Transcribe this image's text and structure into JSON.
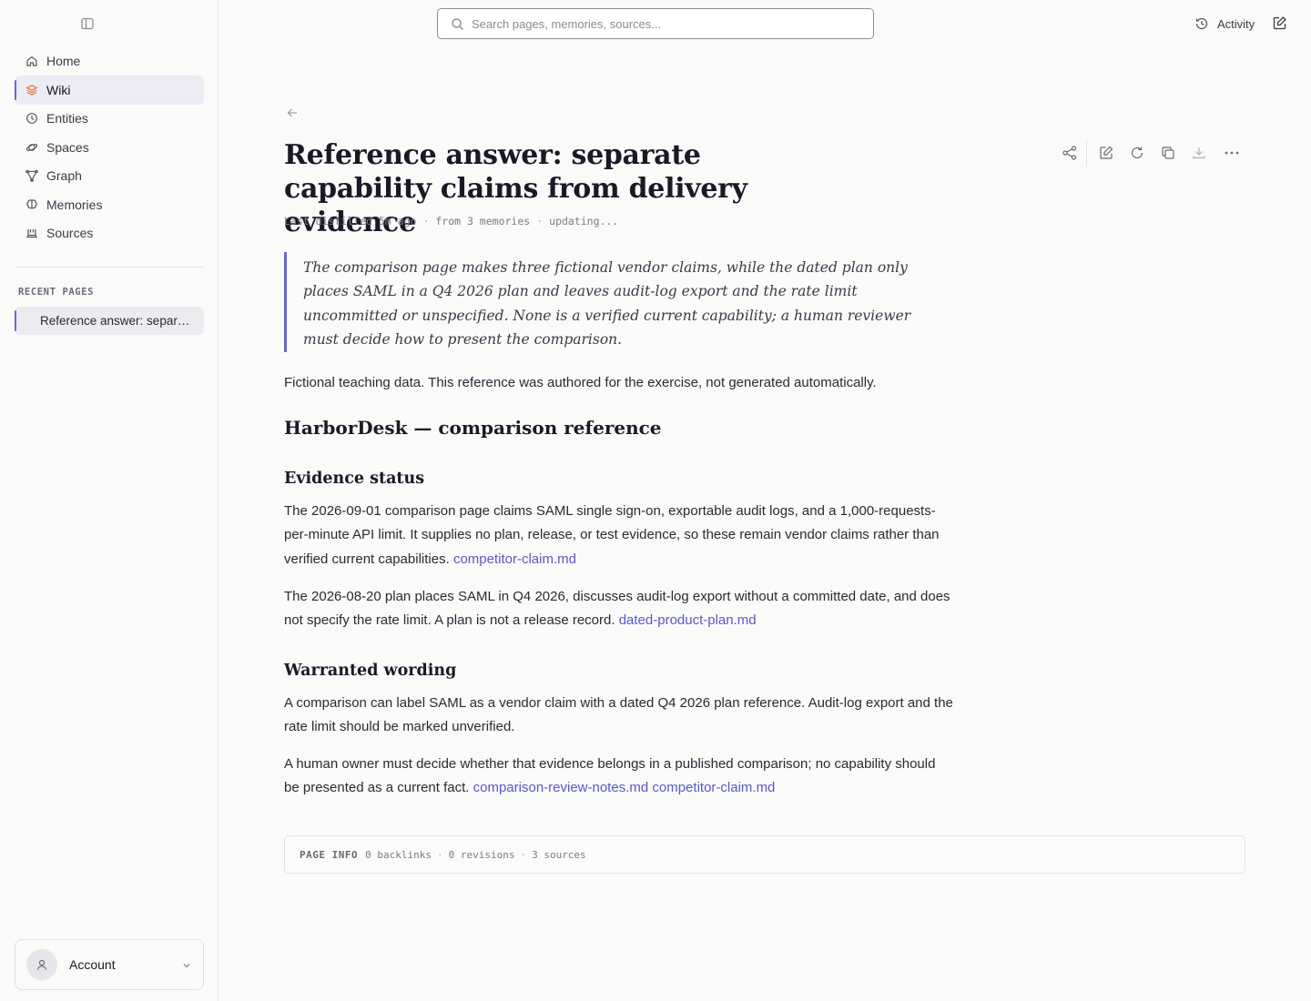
{
  "sidebar": {
    "toggle_icon": "sidebar-toggle-icon",
    "items": [
      {
        "label": "Home",
        "icon": "home-icon",
        "active": false
      },
      {
        "label": "Wiki",
        "icon": "layers-icon",
        "active": true
      },
      {
        "label": "Entities",
        "icon": "clock-icon",
        "active": false
      },
      {
        "label": "Spaces",
        "icon": "orbit-icon",
        "active": false
      },
      {
        "label": "Graph",
        "icon": "graph-icon",
        "active": false
      },
      {
        "label": "Memories",
        "icon": "brain-icon",
        "active": false
      },
      {
        "label": "Sources",
        "icon": "inbox-icon",
        "active": false
      }
    ],
    "recent_title": "RECENT PAGES",
    "recent_pages": [
      "Reference answer: separat..."
    ],
    "account_label": "Account"
  },
  "topbar": {
    "search_placeholder": "Search pages, memories, sources...",
    "activity_label": "Activity"
  },
  "page": {
    "title": "Reference answer: separate capability claims from delivery evidence",
    "meta": {
      "distilled": "Last distilled 5m ago",
      "from": "from 3 memories",
      "status": "updating..."
    },
    "summary": "The comparison page makes three fictional vendor claims, while the dated plan only places SAML in a Q4 2026 plan and leaves audit-log export and the rate limit uncommitted or unspecified. None is a verified current capability; a human reviewer must decide how to present the comparison.",
    "intro": "Fictional teaching data. This reference was authored for the exercise, not generated automatically.",
    "h2": "HarborDesk — comparison reference",
    "sections": [
      {
        "heading": "Evidence status",
        "paragraphs": [
          {
            "text": "The 2026-09-01 comparison page claims SAML single sign-on, exportable audit logs, and a 1,000-requests-per-minute API limit. It supplies no plan, release, or test evidence, so these remain vendor claims rather than verified current capabilities.",
            "links": [
              "competitor-claim.md"
            ]
          },
          {
            "text": "The 2026-08-20 plan places SAML in Q4 2026, discusses audit-log export without a committed date, and does not specify the rate limit. A plan is not a release record.",
            "links": [
              "dated-product-plan.md"
            ]
          }
        ]
      },
      {
        "heading": "Warranted wording",
        "paragraphs": [
          {
            "text": "A comparison can label SAML as a vendor claim with a dated Q4 2026 plan reference. Audit-log export and the rate limit should be marked unverified.",
            "links": []
          },
          {
            "text": "A human owner must decide whether that evidence belongs in a published comparison; no capability should be presented as a current fact.",
            "links": [
              "comparison-review-notes.md",
              "competitor-claim.md"
            ]
          }
        ]
      }
    ],
    "page_info": {
      "label": "PAGE INFO",
      "backlinks": "0 backlinks",
      "revisions": "0 revisions",
      "sources": "3 sources"
    }
  },
  "colors": {
    "accent": "#6b63d6",
    "link": "#5b57c8",
    "wiki_icon": "#d97a44"
  }
}
